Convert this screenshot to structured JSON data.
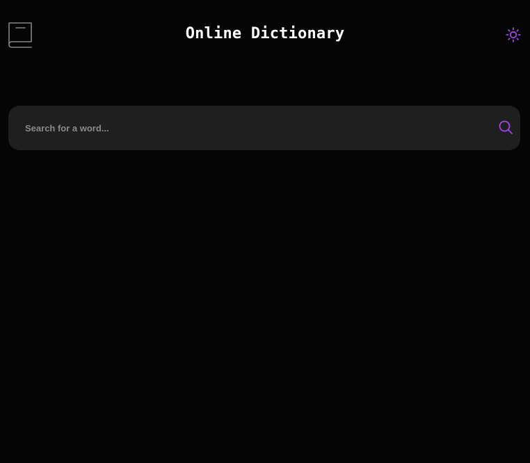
{
  "header": {
    "title": "Online Dictionary",
    "logo_icon": "book-icon",
    "theme_toggle_icon": "sun-icon"
  },
  "search": {
    "placeholder": "Search for a word...",
    "value": "",
    "search_icon": "search-icon"
  },
  "colors": {
    "background": "#050505",
    "search_background": "#1f1f1f",
    "accent": "#a445ed",
    "logo_stroke": "#838383",
    "title_text": "#ffffff",
    "placeholder_text": "#8a8a8a"
  }
}
